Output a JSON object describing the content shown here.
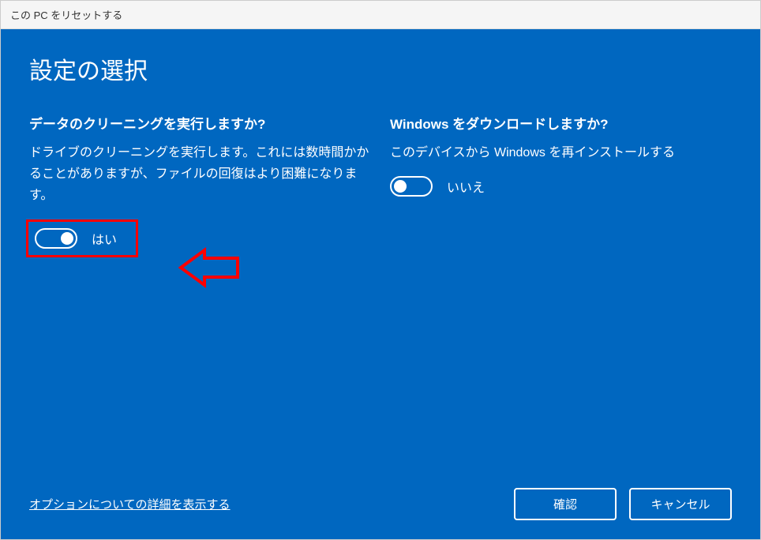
{
  "titlebar": {
    "title": "この PC をリセットする"
  },
  "page": {
    "title": "設定の選択"
  },
  "left": {
    "question": "データのクリーニングを実行しますか?",
    "description": "ドライブのクリーニングを実行します。これには数時間かかることがありますが、ファイルの回復はより困難になります。",
    "toggle_label": "はい"
  },
  "right": {
    "question": "Windows をダウンロードしますか?",
    "description": "このデバイスから Windows を再インストールする",
    "toggle_label": "いいえ"
  },
  "footer": {
    "details_link": "オプションについての詳細を表示する",
    "confirm": "確認",
    "cancel": "キャンセル"
  }
}
